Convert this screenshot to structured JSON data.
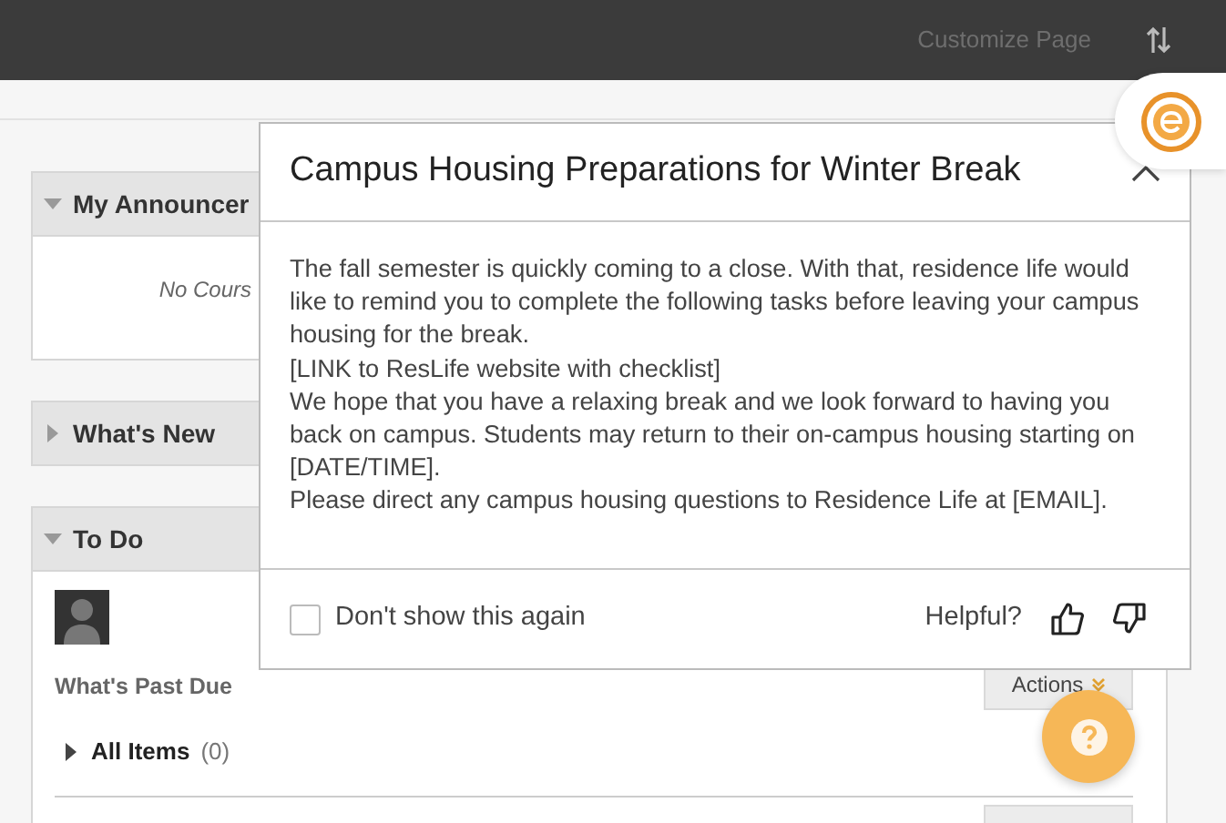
{
  "top_bar": {
    "customize_link": "Customize Page"
  },
  "modules": [
    {
      "kind": "announcements",
      "title": "My Announcer",
      "expanded": true,
      "empty_text": "No Cours"
    },
    {
      "kind": "collapsed",
      "title": "What's New",
      "expanded": false
    },
    {
      "kind": "todo",
      "title": "To Do",
      "expanded": true,
      "section_title": "What's Past Due",
      "actions_label": "Actions",
      "group": {
        "label": "All Items",
        "count": "(0)",
        "expanded": false
      }
    }
  ],
  "dialog": {
    "title": "Campus Housing Preparations for Winter Break",
    "paragraphs": [
      "The fall semester is quickly coming to a close. With that, residence life would like to remind you to complete the following tasks before leaving your campus housing for the break.",
      "[LINK to ResLife website with checklist]",
      "We hope that you have a relaxing break and we look forward to having you back on campus. Students may return to their on-campus housing starting on [DATE/TIME].",
      "Please direct any campus housing questions to Residence Life at [EMAIL]."
    ],
    "dont_show": {
      "label": "Don't show this again",
      "checked": false
    },
    "helpful_label": "Helpful?"
  }
}
